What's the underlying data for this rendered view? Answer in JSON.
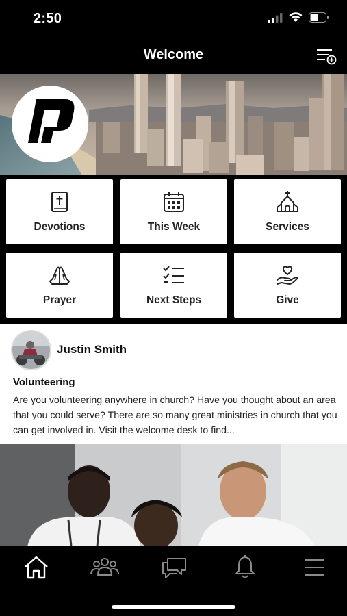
{
  "status_bar": {
    "time": "2:50"
  },
  "header": {
    "title": "Welcome"
  },
  "tiles": [
    {
      "label": "Devotions",
      "icon": "bible-icon"
    },
    {
      "label": "This Week",
      "icon": "calendar-icon"
    },
    {
      "label": "Services",
      "icon": "church-icon"
    },
    {
      "label": "Prayer",
      "icon": "praying-hands-icon"
    },
    {
      "label": "Next Steps",
      "icon": "checklist-icon"
    },
    {
      "label": "Give",
      "icon": "heart-hand-icon"
    }
  ],
  "post": {
    "author": "Justin Smith",
    "title": "Volunteering",
    "body": "Are you volunteering anywhere in church? Have you thought about an area that you could serve? There are so many great ministries in church that you can get involved in. Visit the welcome desk to find..."
  },
  "tab_bar": {
    "items": [
      "home-icon",
      "people-icon",
      "chat-icon",
      "bell-icon",
      "menu-icon"
    ],
    "active_index": 0
  }
}
